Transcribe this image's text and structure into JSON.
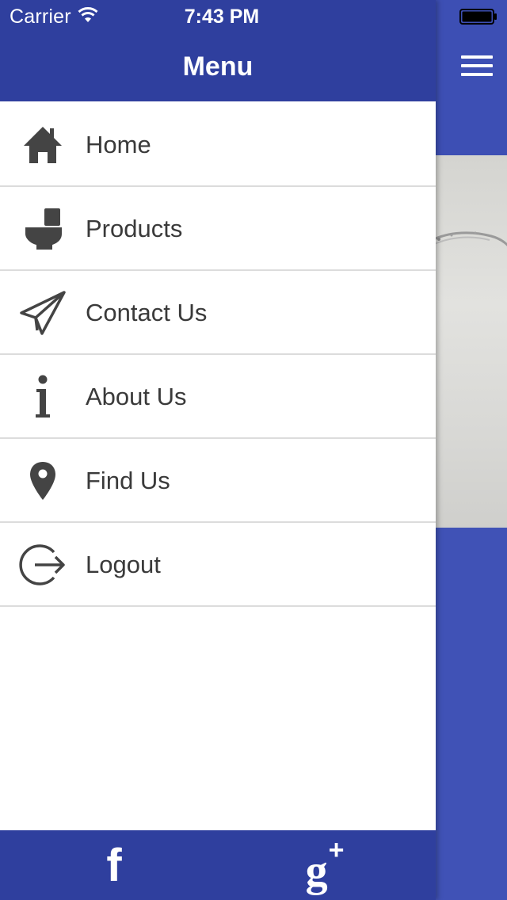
{
  "status_bar": {
    "carrier": "Carrier",
    "time": "7:43 PM",
    "wifi_icon": "wifi-icon",
    "battery_icon": "battery-icon"
  },
  "drawer": {
    "title": "Menu",
    "items": [
      {
        "label": "Home",
        "icon": "home-icon"
      },
      {
        "label": "Products",
        "icon": "toilet-icon"
      },
      {
        "label": "Contact Us",
        "icon": "paper-plane-icon"
      },
      {
        "label": "About Us",
        "icon": "info-icon"
      },
      {
        "label": "Find Us",
        "icon": "map-pin-icon"
      },
      {
        "label": "Logout",
        "icon": "logout-icon"
      }
    ],
    "footer": {
      "facebook_glyph": "f",
      "google_plus_glyph": "g",
      "google_plus_sup": "+",
      "facebook_icon": "facebook-icon",
      "google_plus_icon": "google-plus-icon"
    }
  },
  "main": {
    "menu_button_icon": "hamburger-icon"
  },
  "colors": {
    "primary_dark": "#2f3f9e",
    "primary": "#4052b6",
    "text": "#3a3a3a",
    "icon": "#444444",
    "divider": "#dcdcdc"
  }
}
